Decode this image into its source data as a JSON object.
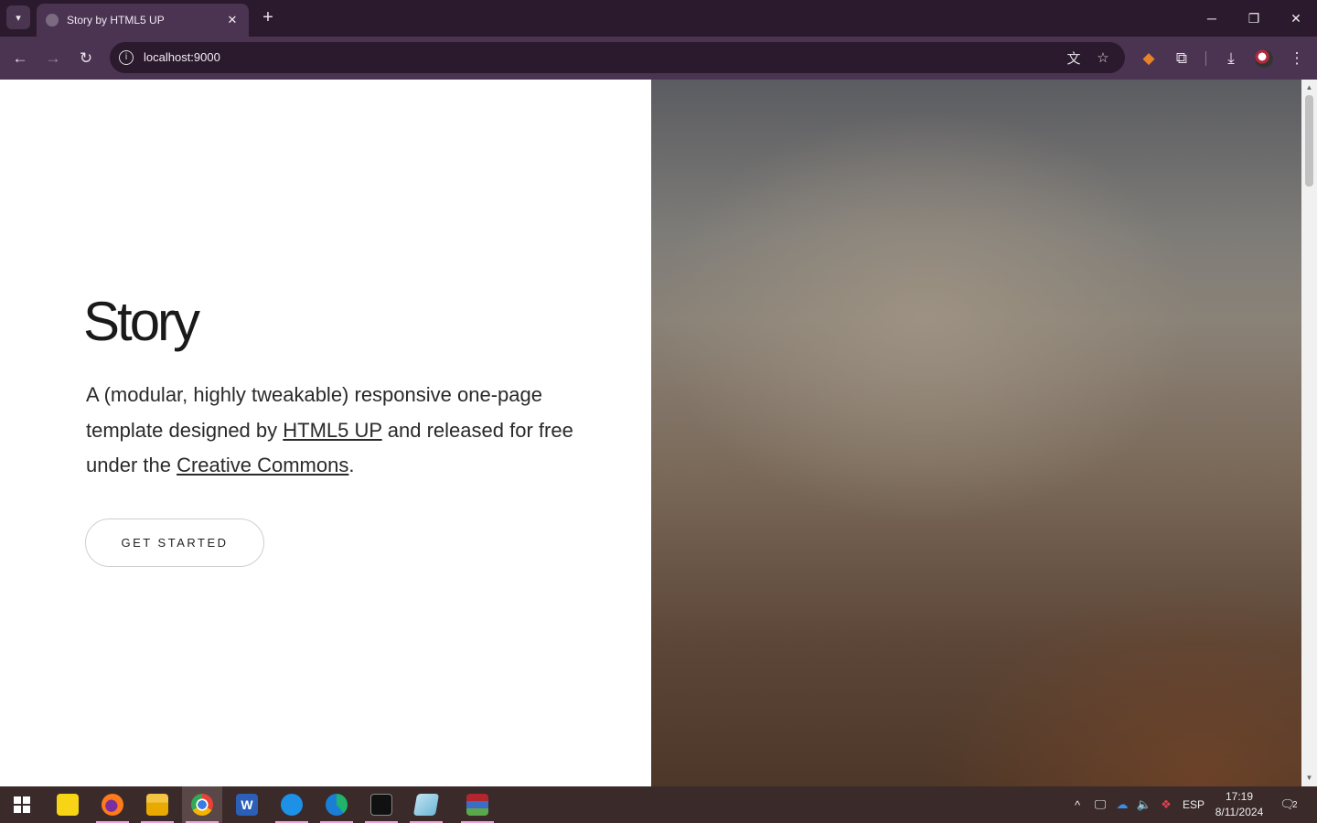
{
  "browser": {
    "tab_title": "Story by HTML5 UP",
    "url": "localhost:9000"
  },
  "page": {
    "title": "Story",
    "paragraph": {
      "part1": "A (modular, highly tweakable) responsive one-page template designed by ",
      "link1": "HTML5 UP",
      "part2": " and released for free under the ",
      "link2": "Creative Commons",
      "part3": "."
    },
    "cta_label": "GET STARTED"
  },
  "taskbar": {
    "apps": [
      "Sticky Notes",
      "Firefox",
      "File Explorer",
      "Chrome",
      "Word",
      "Docker",
      "Edge",
      "Terminal",
      "Notepad",
      "WinRAR"
    ],
    "language": "ESP",
    "time": "17:19",
    "date": "8/11/2024",
    "notification_count": "2"
  },
  "colors": {
    "chrome_dark": "#2b1a2d",
    "chrome_mid": "#4b3452",
    "taskbar": "#3a2a2a"
  }
}
